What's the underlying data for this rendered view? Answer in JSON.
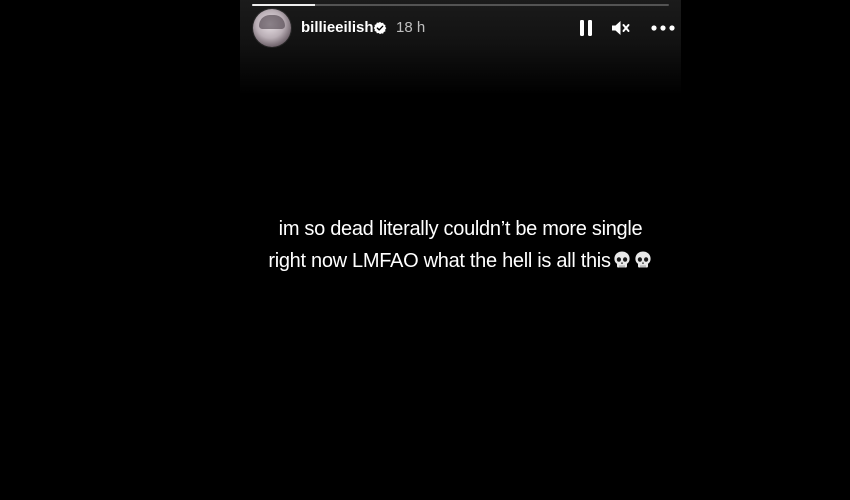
{
  "story": {
    "progress": 0.15,
    "username": "billieeilish",
    "verified": true,
    "timestamp": "18 h",
    "controls": {
      "pause_icon": "pause-icon",
      "mute_icon": "muted-speaker-icon",
      "more_icon": "more-options-icon"
    },
    "caption": {
      "line1": "im so dead literally couldn’t be more single",
      "line2": "right now LMFAO what the hell is all this",
      "emoji": "skull-emoji"
    }
  },
  "colors": {
    "background": "#000000",
    "text": "#ffffff",
    "timestamp": "#b8b8b8",
    "verified_badge": "#ffffff"
  }
}
